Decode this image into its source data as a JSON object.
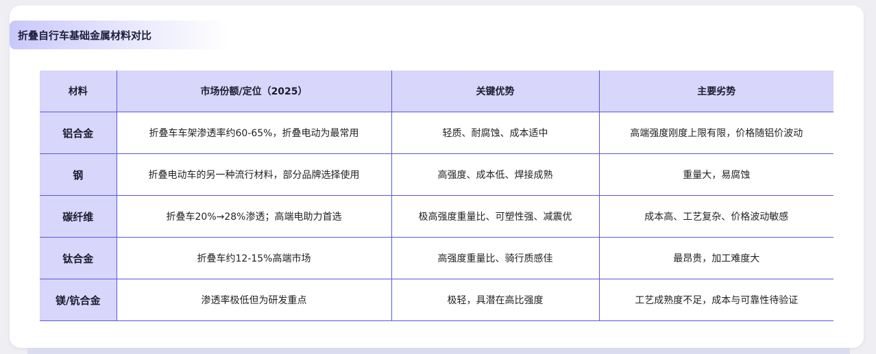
{
  "title": "折叠自行车基础金属材料对比",
  "table": {
    "headers": [
      "材料",
      "市场份额/定位（2025）",
      "关键优势",
      "主要劣势"
    ],
    "rows": [
      [
        "铝合金",
        "折叠车车架渗透率约60-65%，折叠电动为最常用",
        "轻质、耐腐蚀、成本适中",
        "高端强度刚度上限有限，价格随铝价波动"
      ],
      [
        "钢",
        "折叠电动车的另一种流行材料，部分品牌选择使用",
        "高强度、成本低、焊接成熟",
        "重量大，易腐蚀"
      ],
      [
        "碳纤维",
        "折叠车20%→28%渗透；高端电助力首选",
        "极高强度重量比、可塑性强、减震优",
        "成本高、工艺复杂、价格波动敏感"
      ],
      [
        "钛合金",
        "折叠车约12-15%高端市场",
        "高强度重量比、骑行质感佳",
        "最昂贵，加工难度大"
      ],
      [
        "镁/钪合金",
        "渗透率极低但为研发重点",
        "极轻，具潜在高比强度",
        "工艺成熟度不足，成本与可靠性待验证"
      ]
    ]
  },
  "colors": {
    "header_bg": "#d8d6fb",
    "border": "#5a55e6",
    "accent": "#c9c8fb"
  }
}
